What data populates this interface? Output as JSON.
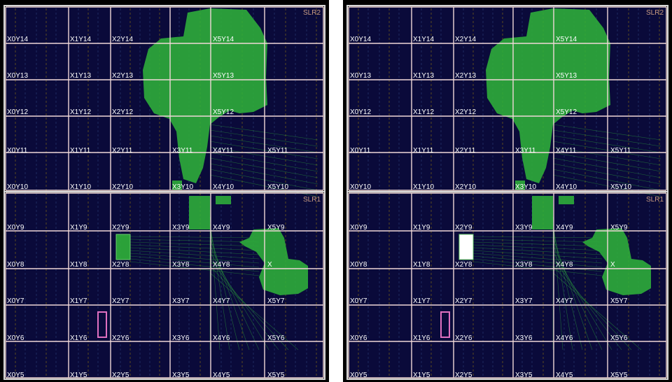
{
  "views": [
    {
      "slr_labels": [
        "SLR2",
        "SLR1"
      ],
      "rows": [
        [
          "X0Y14",
          "X1Y14",
          "X2Y14",
          "",
          "X5Y14"
        ],
        [
          "X0Y13",
          "X1Y13",
          "X2Y13",
          "",
          "X5Y13"
        ],
        [
          "X0Y12",
          "X1Y12",
          "X2Y12",
          "",
          "X5Y12"
        ],
        [
          "X0Y11",
          "X1Y11",
          "X2Y11",
          "X3Y11",
          "X4Y11",
          "X5Y11"
        ],
        [
          "X0Y10",
          "X1Y10",
          "X2Y10",
          "X3Y10",
          "X4Y10",
          "X5Y10"
        ],
        [
          "X0Y9",
          "X1Y9",
          "X2Y9",
          "X3Y9",
          "X4Y9",
          "X5Y9"
        ],
        [
          "X0Y8",
          "X1Y8",
          "X2Y8",
          "X3Y8",
          "X4Y8",
          "X"
        ],
        [
          "X0Y7",
          "X1Y7",
          "X2Y7",
          "X3Y7",
          "X4Y7",
          "X5Y7"
        ],
        [
          "X0Y6",
          "X1Y6",
          "X2Y6",
          "X3Y6",
          "X4Y6",
          "X5Y6"
        ],
        [
          "X0Y5",
          "X1Y5",
          "X2Y5",
          "X3Y5",
          "X4Y5",
          "X5Y5"
        ]
      ]
    },
    {
      "slr_labels": [
        "SLR2",
        "SLR1"
      ],
      "rows": [
        [
          "X0Y14",
          "X1Y14",
          "X2Y14",
          "",
          "X5Y14"
        ],
        [
          "X0Y13",
          "X1Y13",
          "X2Y13",
          "",
          "X5Y13"
        ],
        [
          "X0Y12",
          "X1Y12",
          "X2Y12",
          "",
          "X5Y12"
        ],
        [
          "X0Y11",
          "X1Y11",
          "X2Y11",
          "X3Y11",
          "X4Y11",
          "X5Y11"
        ],
        [
          "X0Y10",
          "X1Y10",
          "X2Y10",
          "X3Y10",
          "X4Y10",
          "X5Y10"
        ],
        [
          "X0Y9",
          "X1Y9",
          "X2Y9",
          "X3Y9",
          "X4Y9",
          "X5Y9"
        ],
        [
          "X0Y8",
          "X1Y8",
          "X2Y8",
          "X3Y8",
          "X4Y8",
          "X"
        ],
        [
          "X0Y7",
          "X1Y7",
          "X2Y7",
          "X3Y7",
          "X4Y7",
          "X5Y7"
        ],
        [
          "X0Y6",
          "X1Y6",
          "X2Y6",
          "X3Y6",
          "X4Y6",
          "X5Y6"
        ],
        [
          "X0Y5",
          "X1Y5",
          "X2Y5",
          "X3Y5",
          "X4Y5",
          "X5Y5"
        ]
      ]
    }
  ],
  "colors": {
    "background": "#000000",
    "fabric": "#0a0a3a",
    "region_border": "#f0d8d8",
    "slr_border": "#d8d8d8",
    "placement_green": "#2fb13a",
    "highlight_white": "#ffffff",
    "pblock_pink": "#e070c0"
  }
}
